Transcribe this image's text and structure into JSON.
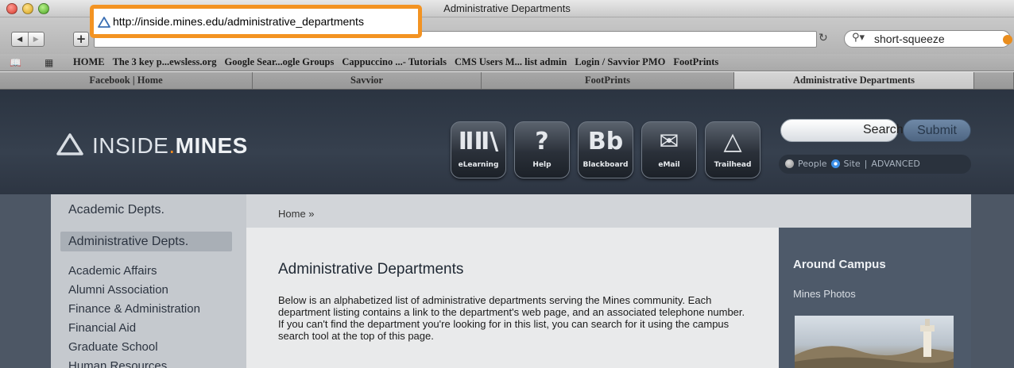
{
  "window": {
    "title": "Administrative Departments"
  },
  "toolbar": {
    "url": "http://inside.mines.edu/administrative_departments",
    "search_query": "short-squeeze"
  },
  "bookmarks": [
    "HOME",
    "The 3 key p...ewsless.org",
    "Google Sear...ogle Groups",
    "Cappuccino ...- Tutorials",
    "CMS Users M... list admin",
    "Login / Savvior PMO",
    "FootPrints"
  ],
  "tabs": [
    {
      "label": "Facebook | Home"
    },
    {
      "label": "Savvior"
    },
    {
      "label": "FootPrints"
    },
    {
      "label": "Administrative Departments",
      "active": true
    }
  ],
  "site": {
    "logo_prefix": "INSIDE",
    "logo_dot": ".",
    "logo_suffix": "MINES",
    "quick_links": [
      {
        "label": "eLearning",
        "glyph": "ⅡⅡ\\",
        "icon": "books-icon"
      },
      {
        "label": "Help",
        "glyph": "?",
        "icon": "help-icon"
      },
      {
        "label": "Blackboard",
        "glyph": "Bb",
        "icon": "blackboard-icon"
      },
      {
        "label": "eMail",
        "glyph": "✉",
        "icon": "mail-icon"
      },
      {
        "label": "Trailhead",
        "glyph": "△",
        "icon": "trailhead-icon"
      }
    ],
    "search_label": "Search",
    "submit_label": "Submit",
    "scope_people": "People",
    "scope_site": "Site",
    "scope_sep": "|",
    "advanced": "ADVANCED"
  },
  "nav": {
    "academic": "Academic Depts.",
    "administrative": "Administrative Depts.",
    "items": [
      "Academic Affairs",
      "Alumni Association",
      "Finance & Administration",
      "Financial Aid",
      "Graduate School",
      "Human Resources"
    ]
  },
  "main": {
    "breadcrumb": "Home »",
    "title": "Administrative Departments",
    "intro": "Below is an alphabetized list of administrative departments serving the Mines community. Each department listing contains a link to the department's web page, and an associated telephone number. If you can't find the department you're looking for in this list, you can search for it using the campus search tool at the top of this page."
  },
  "sidebar": {
    "title": "Around Campus",
    "link": "Mines Photos"
  },
  "colors": {
    "accent": "#f39322",
    "header_bg": "#2b3441",
    "logo_dot": "#f38a1e",
    "radio_on": "#3c8fe8"
  }
}
